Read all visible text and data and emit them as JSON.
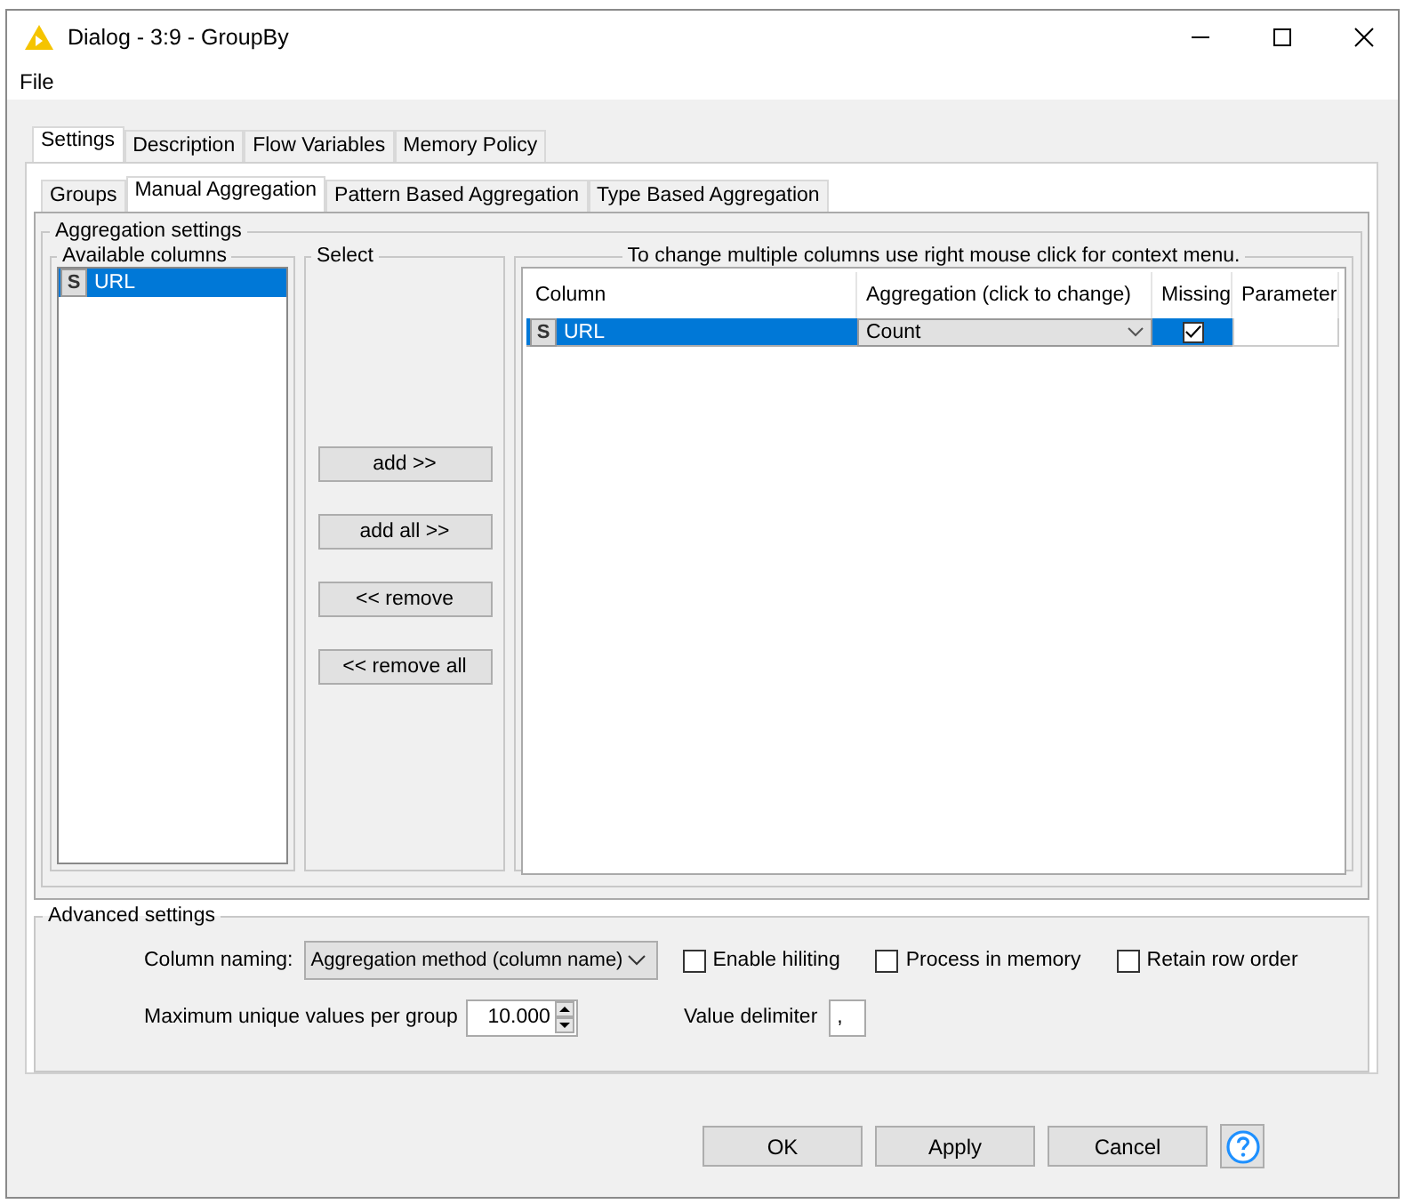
{
  "window": {
    "title": "Dialog - 3:9 - GroupBy"
  },
  "menu": [
    "File"
  ],
  "tabs": [
    {
      "label": "Settings",
      "selected": true
    },
    {
      "label": "Description",
      "selected": false
    },
    {
      "label": "Flow Variables",
      "selected": false
    },
    {
      "label": "Memory Policy",
      "selected": false
    }
  ],
  "subtabs": [
    {
      "label": "Groups",
      "selected": false
    },
    {
      "label": "Manual Aggregation",
      "selected": true
    },
    {
      "label": "Pattern Based Aggregation",
      "selected": false
    },
    {
      "label": "Type Based Aggregation",
      "selected": false
    }
  ],
  "aggregation_settings": {
    "title": "Aggregation settings",
    "available_columns": {
      "title": "Available columns",
      "items": [
        {
          "type_badge": "S",
          "name": "URL",
          "selected": true
        }
      ]
    },
    "select": {
      "title": "Select",
      "buttons": [
        "add >>",
        "add all >>",
        "<< remove",
        "<< remove all"
      ]
    },
    "aggregation_table": {
      "title": "To change multiple columns use right mouse click for context menu.",
      "columns": [
        "Column",
        "Aggregation (click to change)",
        "Missing",
        "Parameter"
      ],
      "rows": [
        {
          "type_badge": "S",
          "column": "URL",
          "aggregation": "Count",
          "missing": true,
          "selected": true
        }
      ]
    }
  },
  "advanced_settings": {
    "title": "Advanced settings",
    "column_naming_label": "Column naming:",
    "column_naming": "Aggregation method (column name)",
    "options": [
      {
        "label": "Enable hiliting",
        "checked": false
      },
      {
        "label": "Process in memory",
        "checked": false
      },
      {
        "label": "Retain row order",
        "checked": false
      }
    ],
    "max_unique_label": "Maximum unique values per group",
    "max_unique": "10.000",
    "delimiter_label": "Value delimiter",
    "delimiter": ","
  },
  "buttons": [
    "OK",
    "Apply",
    "Cancel"
  ]
}
